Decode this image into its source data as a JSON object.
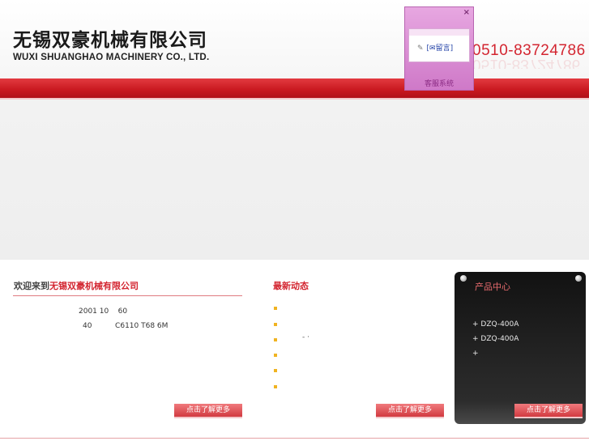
{
  "header": {
    "company_cn": "无锡双豪机械有限公司",
    "company_en": "WUXI SHUANGHAO MACHINERY CO., LTD.",
    "phone": "0510-83724786"
  },
  "chat_widget": {
    "close": "×",
    "contact_icon": "✎",
    "message_label": "[✉留言]",
    "footer": "客服系统"
  },
  "welcome": {
    "title_prefix": "欢迎来到",
    "title_highlight": "无锡双豪机械有限公司",
    "line1": "2001 10    60",
    "line2": "40          C6110 T68 6M",
    "more_label": "点击了解更多"
  },
  "news": {
    "title": "最新动态",
    "item_count_text": "- ·",
    "more_label": "点击了解更多"
  },
  "products": {
    "title": "产品中心",
    "items": [
      "+ DZQ-400A",
      "+ DZQ-400A",
      "+"
    ],
    "more_label": "点击了解更多"
  },
  "colors": {
    "accent": "#d32530",
    "bullet": "#f0b321",
    "chat_bg": "#cf79c8"
  }
}
